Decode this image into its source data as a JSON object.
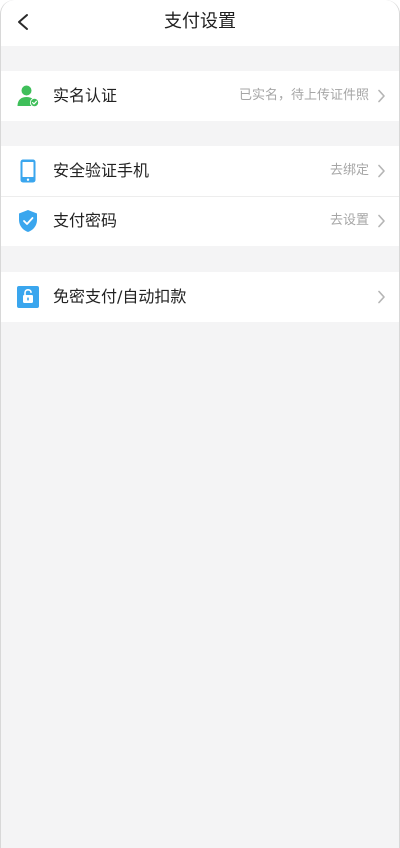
{
  "header": {
    "title": "支付设置",
    "back_icon": "back-arrow-icon"
  },
  "groups": [
    {
      "items": [
        {
          "label": "实名认证",
          "value": "已实名，待上传证件照",
          "icon": "user-verified-icon",
          "icon_color": "#3fbf5a"
        }
      ]
    },
    {
      "items": [
        {
          "label": "安全验证手机",
          "value": "去绑定",
          "icon": "phone-icon",
          "icon_color": "#3aa6ee"
        },
        {
          "label": "支付密码",
          "value": "去设置",
          "icon": "shield-check-icon",
          "icon_color": "#3aa6ee"
        }
      ]
    },
    {
      "items": [
        {
          "label": "免密支付/自动扣款",
          "value": "",
          "icon": "unlock-icon",
          "icon_color": "#3aa6ee"
        }
      ]
    }
  ],
  "colors": {
    "background": "#f4f4f5",
    "card": "#ffffff",
    "primary_text": "#222222",
    "secondary_text": "#a6a6a6",
    "accent_blue": "#3aa6ee",
    "accent_green": "#3fbf5a"
  }
}
